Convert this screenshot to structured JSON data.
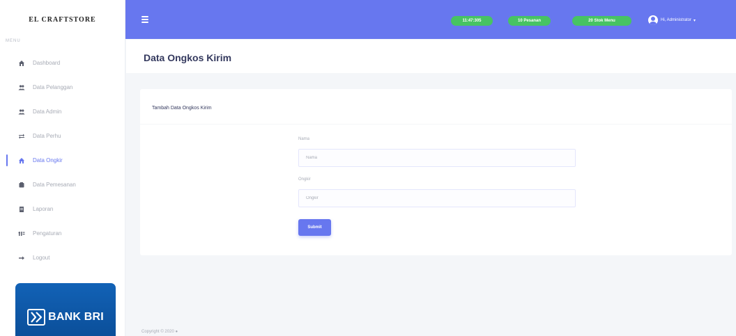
{
  "brand": "EL CRAFTSTORE",
  "menu_header": "MENU",
  "sidebar": {
    "items": [
      {
        "label": "Dashboard",
        "icon": "home-icon"
      },
      {
        "label": "Data Pelanggan",
        "icon": "users-icon"
      },
      {
        "label": "Data Admin",
        "icon": "users-icon"
      },
      {
        "label": "Data Perhu",
        "icon": "exchange-icon"
      },
      {
        "label": "Data Ongkir",
        "icon": "truck-icon",
        "active": true
      },
      {
        "label": "Data Pemesanan",
        "icon": "box-icon"
      },
      {
        "label": "Laporan",
        "icon": "report-icon"
      },
      {
        "label": "Pengaturan",
        "icon": "settings-icon"
      },
      {
        "label": "Logout",
        "icon": "logout-icon"
      }
    ]
  },
  "sidebar_logo": {
    "text": "BANK BRI",
    "color": "#1262b6"
  },
  "topbar": {
    "pills": [
      "11:47:305",
      "10 Pesanan",
      "20 Stok Menu"
    ],
    "user": "Hi, Administrator"
  },
  "page_title": "Data Ongkos Kirim",
  "form": {
    "title": "Tambah Data Ongkos Kirim",
    "nama_label": "Nama",
    "nama_placeholder": "Nama",
    "ongkir_label": "Ongkir",
    "ongkir_placeholder": "Ongkir",
    "submit": "Submit"
  },
  "footer": "Copyright © 2020 ●",
  "colors": {
    "primary": "#6777ef",
    "success": "#47c363",
    "background": "#f4f6f9"
  }
}
